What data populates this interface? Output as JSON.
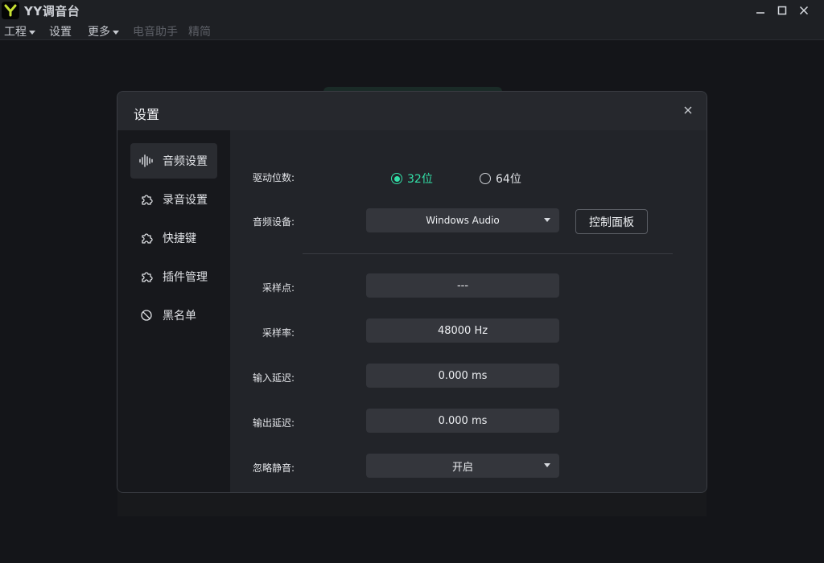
{
  "app": {
    "title": "YY调音台"
  },
  "menu": [
    {
      "label": "工程",
      "has_caret": true,
      "enabled": true
    },
    {
      "label": "设置",
      "has_caret": false,
      "enabled": true
    },
    {
      "label": "更多",
      "has_caret": true,
      "enabled": true
    },
    {
      "label": "电音助手",
      "has_caret": false,
      "enabled": false
    },
    {
      "label": "精简",
      "has_caret": false,
      "enabled": false
    }
  ],
  "dialog": {
    "title": "设置",
    "sidebar": [
      {
        "label": "音频设置",
        "icon": "waveform-icon",
        "active": true
      },
      {
        "label": "录音设置",
        "icon": "puzzle-icon",
        "active": false
      },
      {
        "label": "快捷键",
        "icon": "puzzle-icon",
        "active": false
      },
      {
        "label": "插件管理",
        "icon": "puzzle-icon",
        "active": false
      },
      {
        "label": "黑名单",
        "icon": "block-icon",
        "active": false
      }
    ],
    "audio": {
      "driver_bits_label": "驱动位数:",
      "bits_options": [
        "32位",
        "64位"
      ],
      "bits_selected": "32位",
      "device_label": "音频设备:",
      "device_value": "Windows Audio",
      "control_panel_label": "控制面板",
      "sample_points_label": "采样点:",
      "sample_points_value": "---",
      "sample_rate_label": "采样率:",
      "sample_rate_value": "48000 Hz",
      "input_latency_label": "输入延迟:",
      "input_latency_value": "0.000 ms",
      "output_latency_label": "输出延迟:",
      "output_latency_value": "0.000 ms",
      "ignore_silence_label": "忽略静音:",
      "ignore_silence_value": "开启"
    }
  },
  "colors": {
    "accent": "#33e0a8",
    "logo": "#c7e033"
  }
}
